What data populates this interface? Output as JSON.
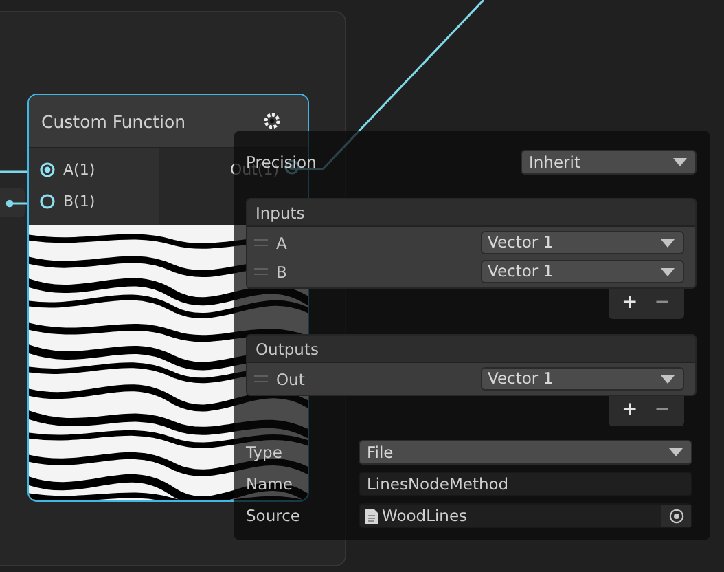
{
  "node": {
    "title": "Custom Function",
    "selected": true,
    "inputs": [
      {
        "label": "A(1)",
        "highlighted": true
      },
      {
        "label": "B(1)",
        "highlighted": false
      }
    ],
    "outputs": [
      {
        "label": "Out(1)",
        "highlighted": true
      }
    ]
  },
  "settings": {
    "precision": {
      "label": "Precision",
      "value": "Inherit"
    },
    "inputs": {
      "title": "Inputs",
      "rows": [
        {
          "name": "A",
          "type": "Vector 1"
        },
        {
          "name": "B",
          "type": "Vector 1"
        }
      ],
      "add": "+",
      "remove": "−"
    },
    "outputs": {
      "title": "Outputs",
      "rows": [
        {
          "name": "Out",
          "type": "Vector 1"
        }
      ],
      "add": "+",
      "remove": "−"
    },
    "type": {
      "label": "Type",
      "value": "File"
    },
    "name": {
      "label": "Name",
      "value": "LinesNodeMethod"
    },
    "source": {
      "label": "Source",
      "value": "WoodLines"
    }
  }
}
